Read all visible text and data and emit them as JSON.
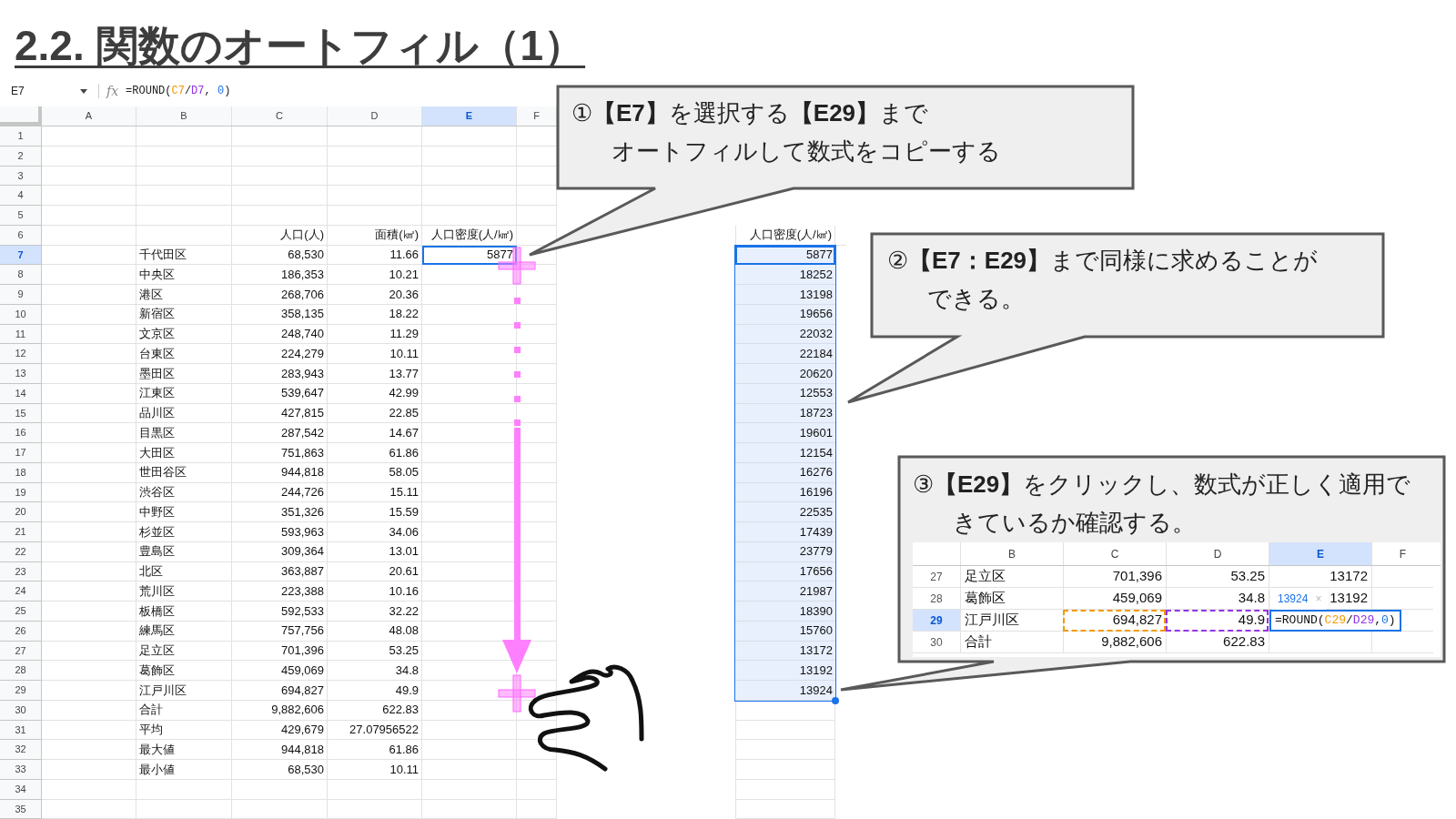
{
  "title": "2.2. 関数のオートフィル（1）",
  "sheet": {
    "name_box": "E7",
    "fx_label": "fx",
    "formula": [
      {
        "text": "=ROUND("
      },
      {
        "text": "C7",
        "color": "#f29900"
      },
      {
        "text": "/"
      },
      {
        "text": "D7",
        "color": "#9334e6"
      },
      {
        "text": ", "
      },
      {
        "text": "0",
        "color": "#1a73e8"
      },
      {
        "text": ")"
      }
    ],
    "columns": [
      {
        "label": "A",
        "selected": false
      },
      {
        "label": "B",
        "selected": false
      },
      {
        "label": "C",
        "selected": false
      },
      {
        "label": "D",
        "selected": false
      },
      {
        "label": "E",
        "selected": true
      },
      {
        "label": "F",
        "selected": false
      }
    ],
    "rows": [
      {
        "num": "1",
        "selected": false
      },
      {
        "num": "2",
        "selected": false
      },
      {
        "num": "3",
        "selected": false
      },
      {
        "num": "4",
        "selected": false
      },
      {
        "num": "5",
        "selected": false
      },
      {
        "num": "6",
        "selected": false,
        "c": "人口(人)",
        "d": "面積(㎢)",
        "e": "人口密度(人/㎢)"
      },
      {
        "num": "7",
        "selected": true,
        "b": "千代田区",
        "c": "68,530",
        "d": "11.66",
        "e": "5877"
      },
      {
        "num": "8",
        "selected": false,
        "b": "中央区",
        "c": "186,353",
        "d": "10.21"
      },
      {
        "num": "9",
        "selected": false,
        "b": "港区",
        "c": "268,706",
        "d": "20.36"
      },
      {
        "num": "10",
        "selected": false,
        "b": "新宿区",
        "c": "358,135",
        "d": "18.22"
      },
      {
        "num": "11",
        "selected": false,
        "b": "文京区",
        "c": "248,740",
        "d": "11.29"
      },
      {
        "num": "12",
        "selected": false,
        "b": "台東区",
        "c": "224,279",
        "d": "10.11"
      },
      {
        "num": "13",
        "selected": false,
        "b": "墨田区",
        "c": "283,943",
        "d": "13.77"
      },
      {
        "num": "14",
        "selected": false,
        "b": "江東区",
        "c": "539,647",
        "d": "42.99"
      },
      {
        "num": "15",
        "selected": false,
        "b": "品川区",
        "c": "427,815",
        "d": "22.85"
      },
      {
        "num": "16",
        "selected": false,
        "b": "目黒区",
        "c": "287,542",
        "d": "14.67"
      },
      {
        "num": "17",
        "selected": false,
        "b": "大田区",
        "c": "751,863",
        "d": "61.86"
      },
      {
        "num": "18",
        "selected": false,
        "b": "世田谷区",
        "c": "944,818",
        "d": "58.05"
      },
      {
        "num": "19",
        "selected": false,
        "b": "渋谷区",
        "c": "244,726",
        "d": "15.11"
      },
      {
        "num": "20",
        "selected": false,
        "b": "中野区",
        "c": "351,326",
        "d": "15.59"
      },
      {
        "num": "21",
        "selected": false,
        "b": "杉並区",
        "c": "593,963",
        "d": "34.06"
      },
      {
        "num": "22",
        "selected": false,
        "b": "豊島区",
        "c": "309,364",
        "d": "13.01"
      },
      {
        "num": "23",
        "selected": false,
        "b": "北区",
        "c": "363,887",
        "d": "20.61"
      },
      {
        "num": "24",
        "selected": false,
        "b": "荒川区",
        "c": "223,388",
        "d": "10.16"
      },
      {
        "num": "25",
        "selected": false,
        "b": "板橋区",
        "c": "592,533",
        "d": "32.22"
      },
      {
        "num": "26",
        "selected": false,
        "b": "練馬区",
        "c": "757,756",
        "d": "48.08"
      },
      {
        "num": "27",
        "selected": false,
        "b": "足立区",
        "c": "701,396",
        "d": "53.25"
      },
      {
        "num": "28",
        "selected": false,
        "b": "葛飾区",
        "c": "459,069",
        "d": "34.8"
      },
      {
        "num": "29",
        "selected": false,
        "b": "江戸川区",
        "c": "694,827",
        "d": "49.9"
      },
      {
        "num": "30",
        "selected": false,
        "b": "合計",
        "c": "9,882,606",
        "d": "622.83"
      },
      {
        "num": "31",
        "selected": false,
        "b": "平均",
        "c": "429,679",
        "d": "27.07956522"
      },
      {
        "num": "32",
        "selected": false,
        "b": "最大値",
        "c": "944,818",
        "d": "61.86"
      },
      {
        "num": "33",
        "selected": false,
        "b": "最小値",
        "c": "68,530",
        "d": "10.11"
      },
      {
        "num": "34",
        "selected": false
      },
      {
        "num": "35",
        "selected": false
      }
    ]
  },
  "result_column": {
    "header": "人口密度(人/㎢)",
    "selected": true,
    "values": [
      "5877",
      "18252",
      "13198",
      "19656",
      "22032",
      "22184",
      "20620",
      "12553",
      "18723",
      "19601",
      "12154",
      "16276",
      "16196",
      "22535",
      "17439",
      "23779",
      "17656",
      "21987",
      "18390",
      "15760",
      "13172",
      "13192",
      "13924"
    ]
  },
  "callouts": [
    {
      "lines": [
        "①**【E7】**を選択する**【E29】**まで",
        "オートフィルして数式をコピーする"
      ]
    },
    {
      "lines": [
        "②**【E7：E29】**まで同様に求めることが",
        "できる。"
      ]
    },
    {
      "lines": [
        "③**【E29】**をクリックし、数式が正しく適用で",
        "きているか確認する。"
      ]
    }
  ],
  "inset": {
    "columns": [
      {
        "label": "B",
        "selected": false
      },
      {
        "label": "C",
        "selected": false
      },
      {
        "label": "D",
        "selected": false
      },
      {
        "label": "E",
        "selected": true
      },
      {
        "label": "F",
        "selected": false
      }
    ],
    "rows": [
      {
        "num": "27",
        "selected": false,
        "b": "足立区",
        "c": "701,396",
        "d": "53.25",
        "e": "13172"
      },
      {
        "num": "28",
        "selected": false,
        "b": "葛飾区",
        "c": "459,069",
        "d": "34.8",
        "e": "13192"
      },
      {
        "num": "29",
        "selected": true,
        "b": "江戸川区",
        "c": "694,827",
        "d": "49.9"
      },
      {
        "num": "30",
        "selected": false,
        "b": "合計",
        "c": "9,882,606",
        "d": "622.83"
      }
    ],
    "tooltip": {
      "value": "13924",
      "close": "×"
    },
    "formula": [
      {
        "text": "=ROUND("
      },
      {
        "text": "C29",
        "color": "#f29900"
      },
      {
        "text": "/"
      },
      {
        "text": "D29",
        "color": "#9334e6"
      },
      {
        "text": ", "
      },
      {
        "text": "0",
        "color": "#1a73e8"
      },
      {
        "text": ")"
      }
    ]
  }
}
